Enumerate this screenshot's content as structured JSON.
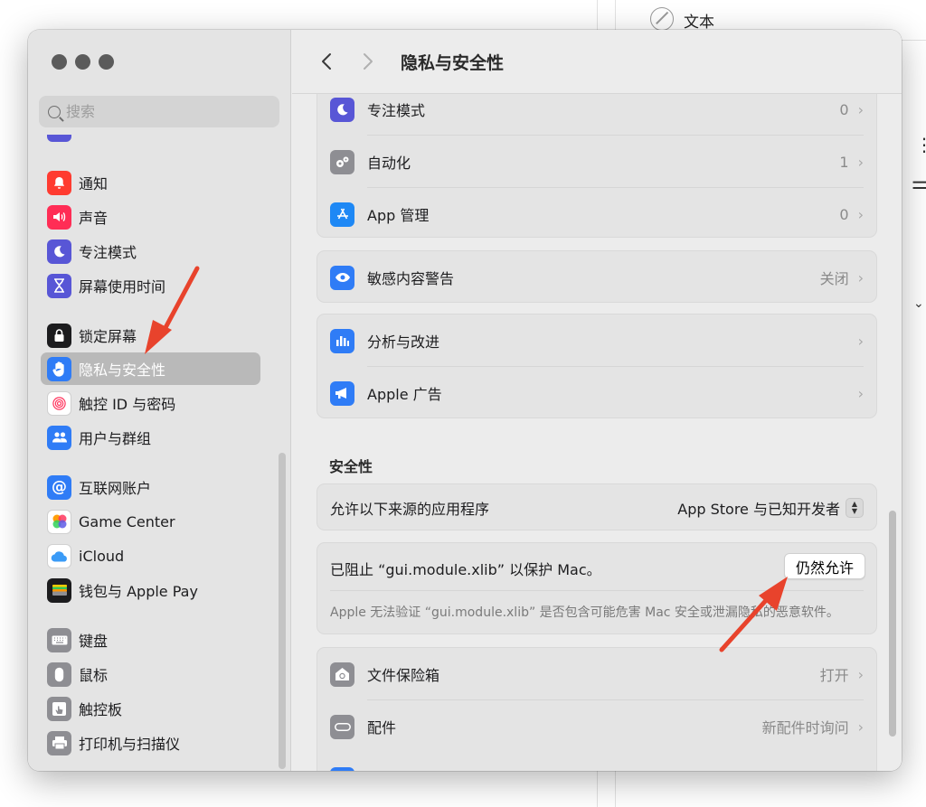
{
  "background": {
    "row_text": "文本"
  },
  "window": {
    "title": "隐私与安全性"
  },
  "sidebar": {
    "search_placeholder": "搜索",
    "items": [
      {
        "label": "通知",
        "icon": "bell-icon",
        "color": "#ff3b30"
      },
      {
        "label": "声音",
        "icon": "speaker-icon",
        "color": "#ff2d55"
      },
      {
        "label": "专注模式",
        "icon": "moon-icon",
        "color": "#5856d6"
      },
      {
        "label": "屏幕使用时间",
        "icon": "hourglass-icon",
        "color": "#5856d6"
      },
      {
        "label": "锁定屏幕",
        "icon": "lock-icon",
        "color": "#1c1c1e"
      },
      {
        "label": "隐私与安全性",
        "icon": "hand-icon",
        "color": "#2f7cf6"
      },
      {
        "label": "触控 ID 与密码",
        "icon": "fingerprint-icon",
        "color": "#ffffff"
      },
      {
        "label": "用户与群组",
        "icon": "users-icon",
        "color": "#2f7cf6"
      },
      {
        "label": "互联网账户",
        "icon": "at-icon",
        "color": "#2f7cf6"
      },
      {
        "label": "Game Center",
        "icon": "game-center-icon",
        "color": "#ffffff"
      },
      {
        "label": "iCloud",
        "icon": "cloud-icon",
        "color": "#ffffff"
      },
      {
        "label": "钱包与 Apple Pay",
        "icon": "wallet-icon",
        "color": "#1c1c1e"
      },
      {
        "label": "键盘",
        "icon": "keyboard-icon",
        "color": "#8e8e93"
      },
      {
        "label": "鼠标",
        "icon": "mouse-icon",
        "color": "#8e8e93"
      },
      {
        "label": "触控板",
        "icon": "trackpad-icon",
        "color": "#8e8e93"
      },
      {
        "label": "打印机与扫描仪",
        "icon": "printer-icon",
        "color": "#8e8e93"
      }
    ]
  },
  "main": {
    "group1": [
      {
        "label": "专注模式",
        "value": "0",
        "icon": "moon-icon",
        "color": "#5856d6"
      },
      {
        "label": "自动化",
        "value": "1",
        "icon": "gears-icon",
        "color": "#8e8e93"
      },
      {
        "label": "App 管理",
        "value": "0",
        "icon": "app-store-icon",
        "color": "#1e88f5"
      }
    ],
    "sensitive": {
      "label": "敏感内容警告",
      "value": "关闭",
      "icon": "eye-icon",
      "color": "#2f7cf6"
    },
    "group3": [
      {
        "label": "分析与改进",
        "icon": "chart-icon",
        "color": "#2f7cf6"
      },
      {
        "label": "Apple 广告",
        "icon": "megaphone-icon",
        "color": "#2f7cf6"
      }
    ],
    "security_title": "安全性",
    "allow_sources": {
      "label": "允许以下来源的应用程序",
      "value": "App Store 与已知开发者"
    },
    "blocked": {
      "message": "已阻止 “gui.module.xlib” 以保护 Mac。",
      "button": "仍然允许",
      "note": "Apple 无法验证 “gui.module.xlib” 是否包含可能危害 Mac 安全或泄漏隐私的恶意软件。"
    },
    "group5": [
      {
        "label": "文件保险箱",
        "value": "打开",
        "icon": "vault-icon",
        "color": "#8e8e93"
      },
      {
        "label": "配件",
        "value": "新配件时询问",
        "icon": "accessory-icon",
        "color": "#8e8e93"
      }
    ]
  },
  "colors": {
    "annotation_arrow": "#e8432c"
  }
}
